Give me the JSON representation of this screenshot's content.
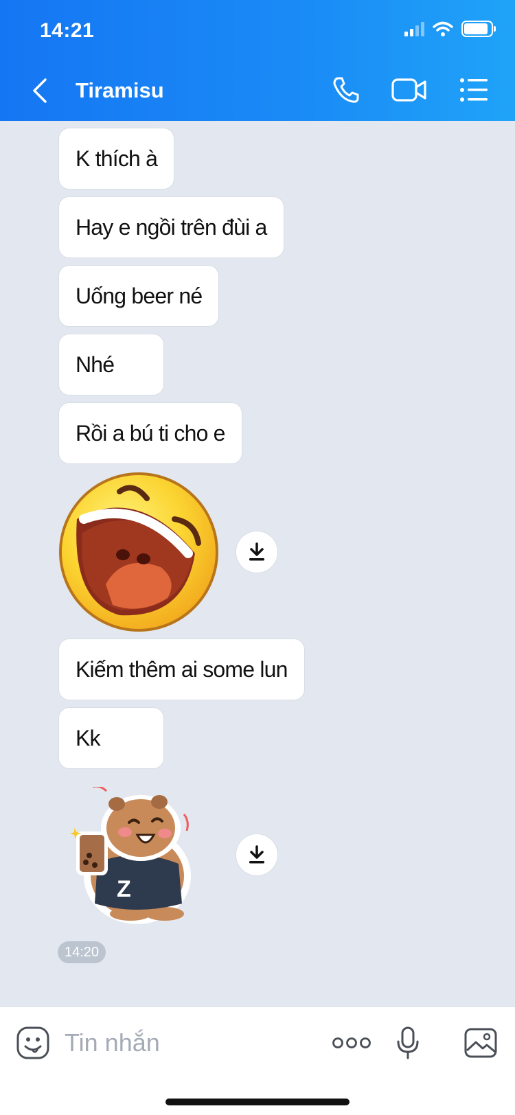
{
  "status_bar": {
    "time": "14:21"
  },
  "header": {
    "title": "Tiramisu",
    "icons": [
      "back-chevron-icon",
      "phone-icon",
      "video-camera-icon",
      "list-menu-icon"
    ]
  },
  "messages": [
    {
      "type": "text",
      "text": "K thích à"
    },
    {
      "type": "text",
      "text": "Hay e ngồi trên đùi a"
    },
    {
      "type": "text",
      "text": "Uống beer né"
    },
    {
      "type": "text",
      "text": "Nhé"
    },
    {
      "type": "text",
      "text": "Rồi a bú ti cho e"
    },
    {
      "type": "sticker",
      "sticker": "laughing-emoji-sticker"
    },
    {
      "type": "text",
      "text": "Kiếm thêm ai some lun"
    },
    {
      "type": "text",
      "text": "Kk"
    },
    {
      "type": "sticker",
      "sticker": "capybara-bubble-tea-sticker"
    }
  ],
  "timestamp": "14:20",
  "input_bar": {
    "placeholder": "Tin nhắn",
    "icons": [
      "sticker-face-icon",
      "more-dots-icon",
      "microphone-icon",
      "image-icon"
    ]
  },
  "colors": {
    "header_start": "#1576f3",
    "header_end": "#1fa3f8",
    "chat_background": "#e3e8f0",
    "bubble": "#ffffff"
  }
}
